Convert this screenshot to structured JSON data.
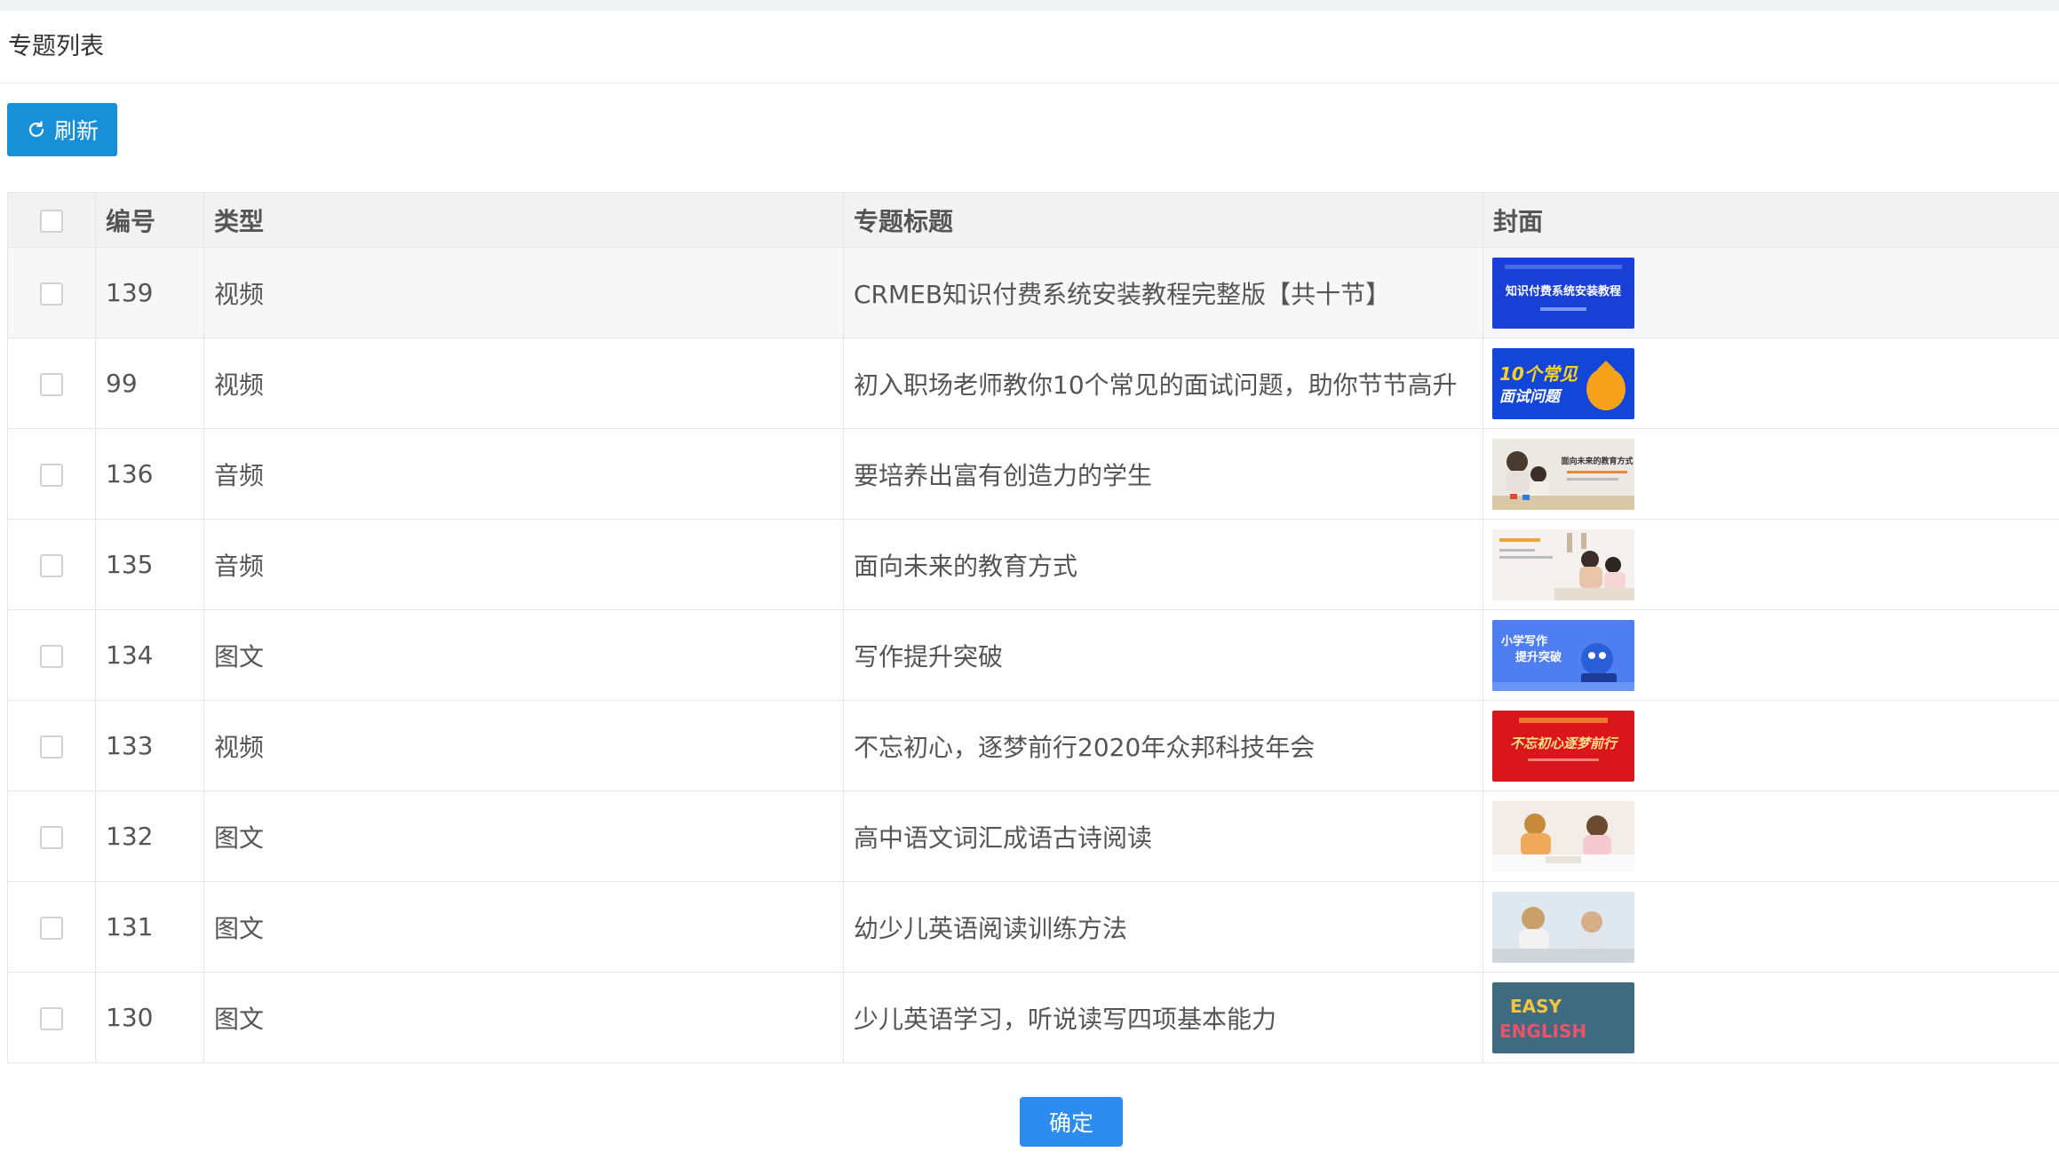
{
  "panel": {
    "title": "专题列表"
  },
  "toolbar": {
    "refresh_label": "刷新",
    "refresh_icon": "refresh-icon"
  },
  "table": {
    "columns": [
      "编号",
      "类型",
      "专题标题",
      "封面"
    ],
    "rows": [
      {
        "id": "139",
        "type": "视频",
        "title": "CRMEB知识付费系统安装教程完整版【共十节】",
        "cover": {
          "kind": "banner-blue",
          "text": "知识付费系统安装教程"
        }
      },
      {
        "id": "99",
        "type": "视频",
        "title": "初入职场老师教你10个常见的面试问题，助你节节高升",
        "cover": {
          "kind": "banner-interview",
          "text": "10个常见面试问题"
        }
      },
      {
        "id": "136",
        "type": "音频",
        "title": "要培养出富有创造力的学生",
        "cover": {
          "kind": "photo-kids-play",
          "text": "面向未来的教育方式"
        }
      },
      {
        "id": "135",
        "type": "音频",
        "title": "面向未来的教育方式",
        "cover": {
          "kind": "photo-family",
          "text": ""
        }
      },
      {
        "id": "134",
        "type": "图文",
        "title": "写作提升突破",
        "cover": {
          "kind": "banner-writing",
          "text": "小学写作提升突破"
        }
      },
      {
        "id": "133",
        "type": "视频",
        "title": "不忘初心，逐梦前行2020年众邦科技年会",
        "cover": {
          "kind": "banner-red",
          "text": "不忘初心逐梦前行"
        }
      },
      {
        "id": "132",
        "type": "图文",
        "title": "高中语文词汇成语古诗阅读",
        "cover": {
          "kind": "photo-kids-write",
          "text": ""
        }
      },
      {
        "id": "131",
        "type": "图文",
        "title": "幼少儿英语阅读训练方法",
        "cover": {
          "kind": "photo-kids-study",
          "text": ""
        }
      },
      {
        "id": "130",
        "type": "图文",
        "title": "少儿英语学习，听说读写四项基本能力",
        "cover": {
          "kind": "photo-english",
          "text": "EASY ENGLISH"
        }
      }
    ]
  },
  "footer": {
    "confirm_label": "确定"
  },
  "colors": {
    "primary": "#1890d8",
    "confirm": "#2d8cf0",
    "header_bg": "#f2f2f2"
  }
}
